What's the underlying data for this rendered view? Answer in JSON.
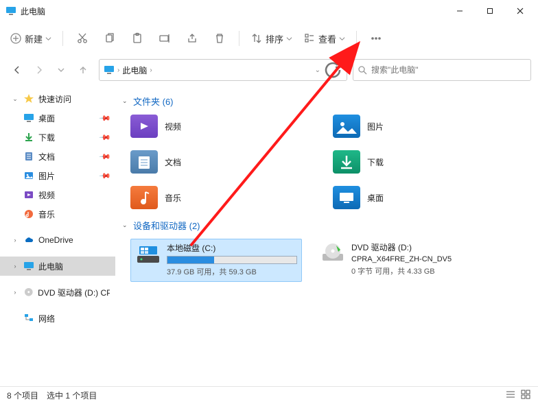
{
  "window": {
    "title": "此电脑"
  },
  "toolbar": {
    "new": "新建",
    "sort": "排序",
    "view": "查看"
  },
  "address": {
    "root": "此电脑"
  },
  "search": {
    "placeholder": "搜索\"此电脑\""
  },
  "sidebar": {
    "quick": "快速访问",
    "desktop": "桌面",
    "downloads": "下载",
    "documents": "文档",
    "pictures": "图片",
    "videos": "视频",
    "music": "音乐",
    "onedrive": "OneDrive",
    "thispc": "此电脑",
    "dvd": "DVD 驱动器 (D:) CP",
    "network": "网络"
  },
  "groups": {
    "folders": "文件夹 (6)",
    "devices": "设备和驱动器 (2)"
  },
  "folders": {
    "videos": "视频",
    "pictures": "图片",
    "documents": "文档",
    "downloads": "下载",
    "music": "音乐",
    "desktop": "桌面"
  },
  "drives": {
    "c": {
      "name": "本地磁盘 (C:)",
      "info": "37.9 GB 可用，共 59.3 GB",
      "used_pct": 36
    },
    "d": {
      "name": "DVD 驱动器 (D:)",
      "label": "CPRA_X64FRE_ZH-CN_DV5",
      "info": "0 字节 可用，共 4.33 GB"
    }
  },
  "status": {
    "count": "8 个项目",
    "selected": "选中 1 个项目"
  }
}
